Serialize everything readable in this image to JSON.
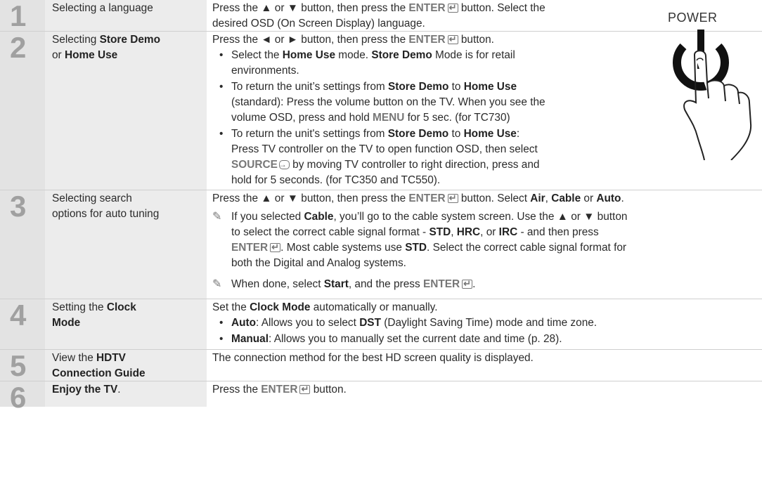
{
  "power_label": "POWER",
  "steps": [
    {
      "number": "1",
      "label_parts": [
        "Selecting a language"
      ],
      "text": [
        [
          "Press the ▲ or ▼ button, then press the ",
          "ENTER",
          " button. Select the"
        ],
        [
          "desired OSD (On Screen Display) language."
        ]
      ]
    },
    {
      "number": "2",
      "label_a": "Selecting ",
      "label_b": "Store Demo",
      "label_c": "or ",
      "label_d": "Home Use",
      "intro_a": "Press the ◄ or ► button, then press the ",
      "intro_enter": "ENTER",
      "intro_b": " button.",
      "bullet1": {
        "t1": "Select the ",
        "b1": "Home Use",
        "t2": " mode. ",
        "b2": "Store Demo",
        "t3": " Mode is for retail",
        "line2": "environments."
      },
      "bullet2": {
        "t1": "To return the unit’s settings from ",
        "b1": "Store Demo",
        "t2": " to ",
        "b2": "Home Use",
        "line2": "(standard): Press the volume button on the TV. When you see the",
        "line3a": "volume OSD, press and hold ",
        "menu": "MENU",
        "line3b": " for 5 sec. (for TC730)"
      },
      "bullet3": {
        "t1": "To return the unit's settings from ",
        "b1": "Store Demo",
        "t2": " to ",
        "b2": "Home Use",
        "t3": ":",
        "line2": "Press TV controller on the TV to open function OSD, then select",
        "source": "SOURCE",
        "line3b": " by moving TV controller to right direction, press and",
        "line4": "hold for 5 seconds. (for TC350 and TC550)."
      }
    },
    {
      "number": "3",
      "label_line1": "Selecting search",
      "label_line2": "options for auto tuning",
      "intro_a": "Press the ▲ or ▼ button, then press the ",
      "intro_enter": "ENTER",
      "intro_b": " button. Select ",
      "air": "Air",
      "comma": ", ",
      "cable": "Cable",
      "or": " or ",
      "auto": "Auto",
      "period": ".",
      "note1": {
        "t1": "If you selected ",
        "b1": "Cable",
        "t2": ", you’ll go to the cable system screen. Use the ▲ or ▼ button",
        "line2a": "to select the correct cable signal format - ",
        "std": "STD",
        "c1": ", ",
        "hrc": "HRC",
        "c2": ", or ",
        "irc": "IRC",
        "line2b": " - and then press",
        "enter": "ENTER",
        "line3a": ". Most cable systems use ",
        "std2": "STD",
        "line3b": ". Select the correct cable signal format for",
        "line4": "both the Digital and Analog systems."
      },
      "note2": {
        "t1": "When done, select ",
        "start": "Start",
        "t2": ", and the press ",
        "enter": "ENTER",
        "t3": "."
      }
    },
    {
      "number": "4",
      "label_a": "Setting the ",
      "label_b": "Clock",
      "label_c": "Mode",
      "intro_a": "Set the ",
      "intro_b": "Clock Mode",
      "intro_c": " automatically or manually.",
      "bullet1": {
        "b": "Auto",
        "t1": ": Allows you to select ",
        "dst": "DST",
        "t2": " (Daylight Saving Time) mode and time zone."
      },
      "bullet2": {
        "b": "Manual",
        "t1": ": Allows you to manually set the current date and time (p. 28)."
      }
    },
    {
      "number": "5",
      "label_a": "View the ",
      "label_b": "HDTV",
      "label_c": "Connection Guide",
      "text": "The connection method for the best HD screen quality is displayed."
    },
    {
      "number": "6",
      "label_a": "Enjoy the TV",
      "label_b": ".",
      "intro_a": "Press the ",
      "intro_enter": "ENTER",
      "intro_b": " button."
    }
  ]
}
